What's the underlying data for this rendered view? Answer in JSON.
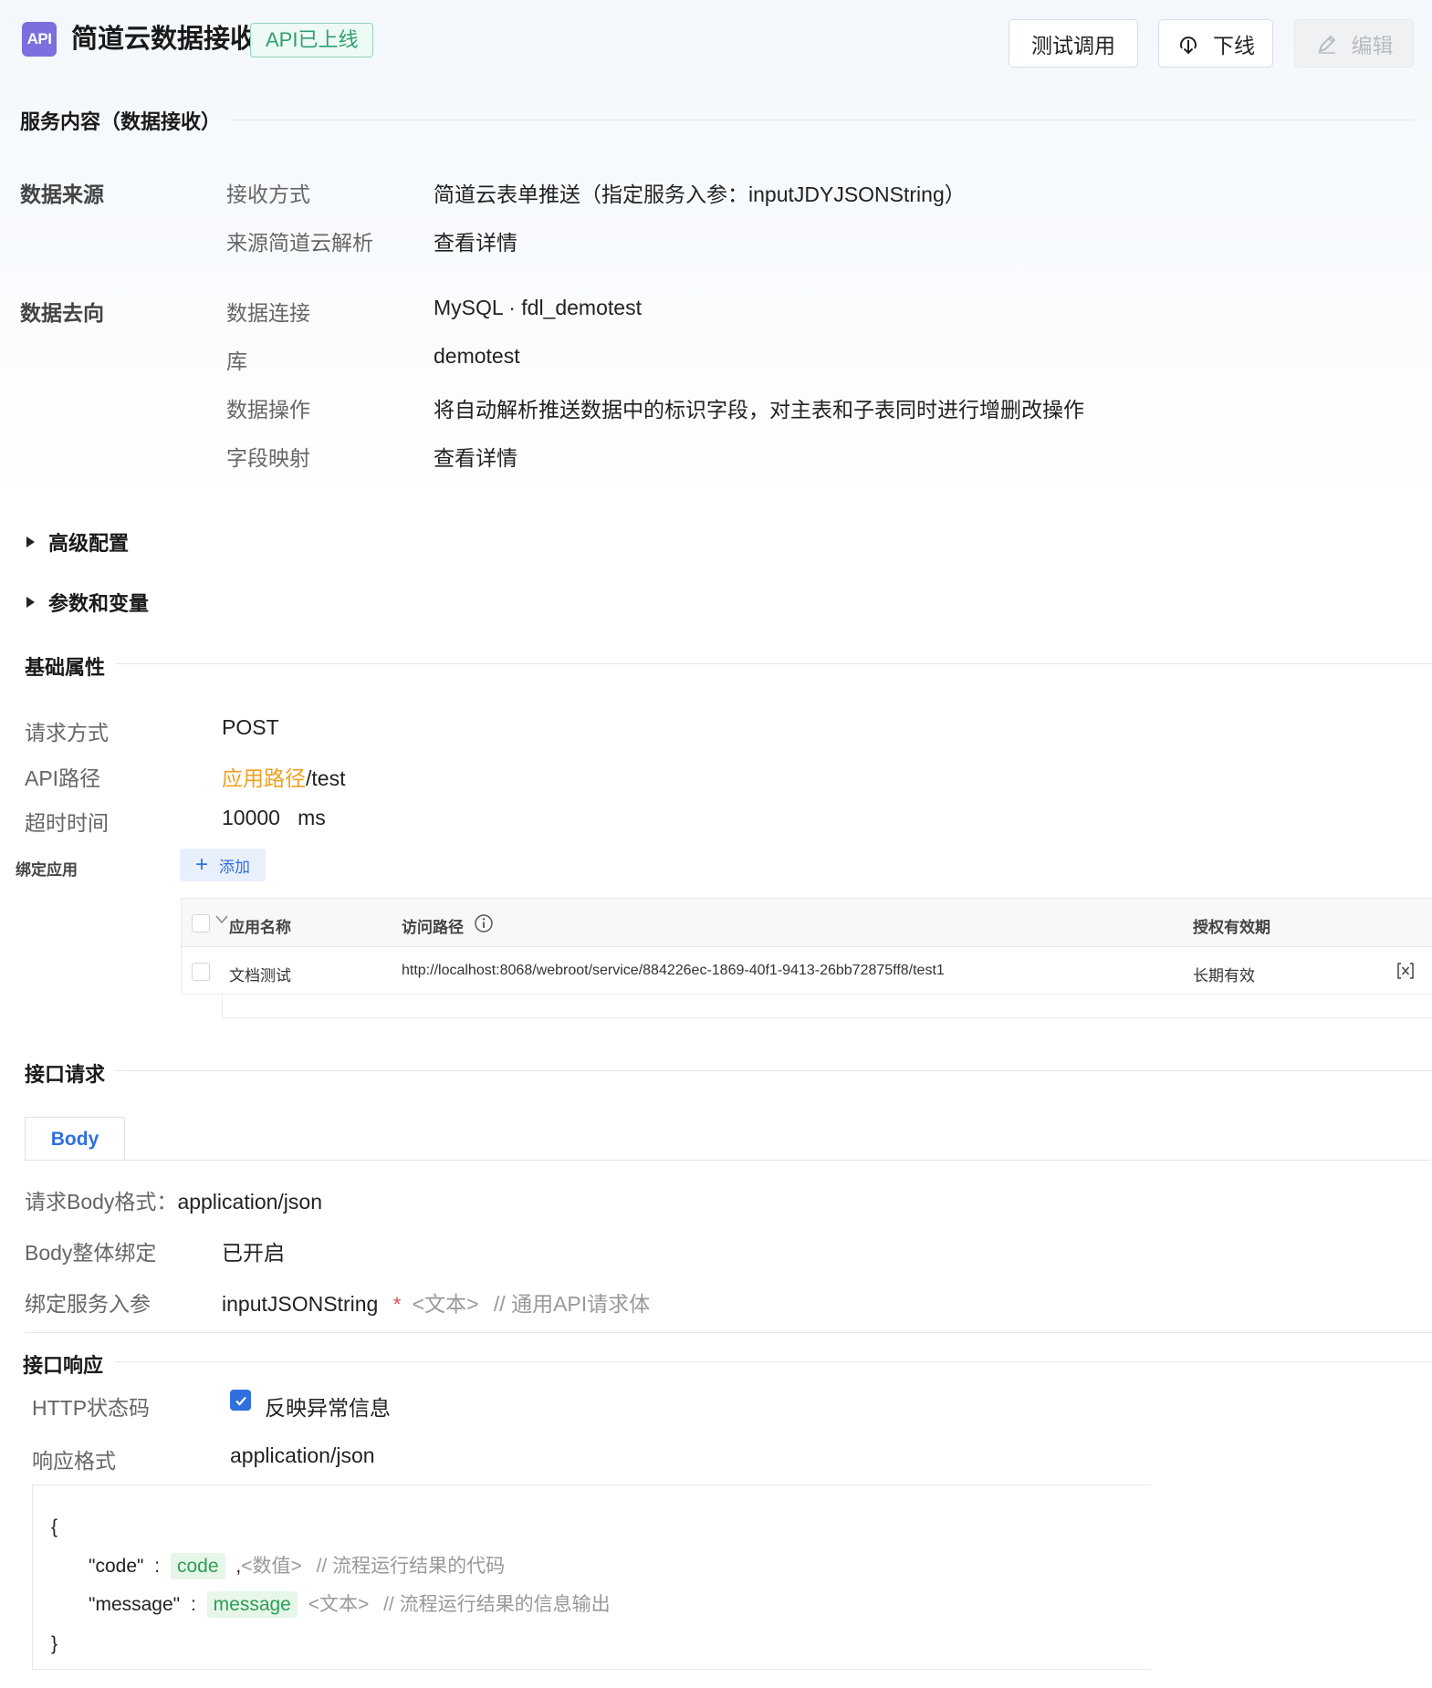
{
  "header": {
    "logo_text": "API",
    "title": "简道云数据接收",
    "status": "API已上线",
    "buttons": {
      "test": "测试调用",
      "offline": "下线",
      "edit": "编辑"
    }
  },
  "service": {
    "section_title": "服务内容（数据接收）",
    "source": {
      "group_label": "数据来源",
      "rows": [
        {
          "label": "接收方式",
          "value": "简道云表单推送（指定服务入参：inputJDYJSONString）"
        },
        {
          "label": "来源简道云解析",
          "value": "查看详情"
        }
      ]
    },
    "target": {
      "group_label": "数据去向",
      "rows": [
        {
          "label": "数据连接",
          "value": "MySQL · fdl_demotest"
        },
        {
          "label": "库",
          "value": "demotest"
        },
        {
          "label": "数据操作",
          "value": "将自动解析推送数据中的标识字段，对主表和子表同时进行增删改操作"
        },
        {
          "label": "字段映射",
          "value": "查看详情"
        }
      ]
    }
  },
  "collapsibles": {
    "advanced": "高级配置",
    "params": "参数和变量"
  },
  "basic": {
    "section_title": "基础属性",
    "method": {
      "label": "请求方式",
      "value": "POST"
    },
    "path": {
      "label": "API路径",
      "prefix": "应用路径",
      "suffix": "/test"
    },
    "timeout": {
      "label": "超时时间",
      "value": "10000",
      "unit": "ms"
    },
    "bind_app": {
      "label": "绑定应用",
      "add_label": "添加"
    },
    "table": {
      "headers": {
        "name": "应用名称",
        "path": "访问路径",
        "validity": "授权有效期"
      },
      "rows": [
        {
          "name": "文档测试",
          "path": "http://localhost:8068/webroot/service/884226ec-1869-40f1-9413-26bb72875ff8/test1",
          "validity": "长期有效"
        }
      ]
    }
  },
  "request": {
    "section_title": "接口请求",
    "tab": "Body",
    "body_format": {
      "label": "请求Body格式：",
      "value": "application/json"
    },
    "whole_bind": {
      "label": "Body整体绑定",
      "value": "已开启"
    },
    "bind_param": {
      "label": "绑定服务入参",
      "name": "inputJSONString",
      "star": "*",
      "type": "<文本>",
      "comment": "// 通用API请求体"
    }
  },
  "response": {
    "section_title": "接口响应",
    "http_status": {
      "label": "HTTP状态码",
      "checkbox_label": "反映异常信息",
      "checked": true
    },
    "format": {
      "label": "响应格式",
      "value": "application/json"
    },
    "code": {
      "open": "{",
      "close": "}",
      "line1": {
        "key": "\"code\"",
        "colon": ":",
        "chip": "code",
        "sep": ",",
        "type": "<数值>",
        "comment": "// 流程运行结果的代码"
      },
      "line2": {
        "key": "\"message\"",
        "colon": ":",
        "chip": "message",
        "type": "<文本>",
        "comment": "// 流程运行结果的信息输出"
      }
    }
  }
}
